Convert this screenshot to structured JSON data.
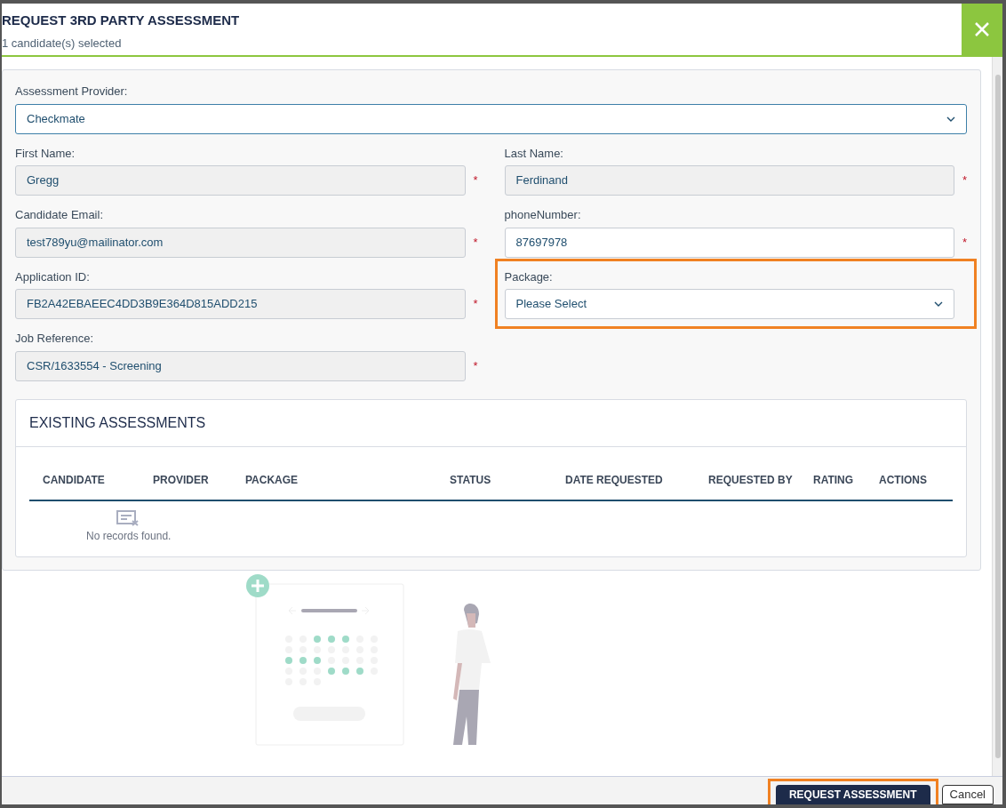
{
  "dialog": {
    "title": "REQUEST 3RD PARTY ASSESSMENT",
    "subtitle": "1 candidate(s) selected"
  },
  "provider": {
    "label": "Assessment Provider:",
    "value": "Checkmate"
  },
  "fields": [
    {
      "label": "First Name:",
      "value": "Gregg",
      "kind": "readonly",
      "required_mark": "*"
    },
    {
      "label": "Last Name:",
      "value": "Ferdinand",
      "kind": "readonly",
      "required_mark": "*"
    },
    {
      "label": "Candidate Email:",
      "value": "test789yu@mailinator.com",
      "kind": "readonly",
      "required_mark": "*"
    },
    {
      "label": "phoneNumber:",
      "value": "87697978",
      "kind": "input",
      "required_mark": "*"
    },
    {
      "label": "Application ID:",
      "value": "FB2A42EBAEEC4DD3B9E364D815ADD215",
      "kind": "readonly",
      "required_mark": "*"
    },
    {
      "label": "Package:",
      "value": "Please Select",
      "kind": "select",
      "highlighted": true
    },
    {
      "label": "Job Reference:",
      "value": "CSR/1633554 - Screening",
      "kind": "readonly",
      "required_mark": "*"
    }
  ],
  "existing_assessments": {
    "title": "EXISTING ASSESSMENTS",
    "columns": [
      "CANDIDATE",
      "PROVIDER",
      "PACKAGE",
      "STATUS",
      "DATE REQUESTED",
      "REQUESTED BY",
      "RATING",
      "ACTIONS"
    ],
    "empty_text": "No records found."
  },
  "footer_buttons": [
    {
      "label": "REQUEST ASSESSMENT",
      "kind": "primary",
      "highlighted": true
    },
    {
      "label": "Cancel",
      "kind": "secondary"
    }
  ]
}
